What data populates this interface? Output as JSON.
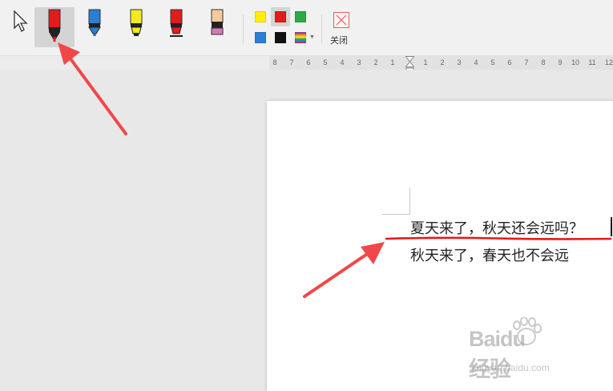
{
  "toolbar": {
    "tools": [
      {
        "name": "pointer-tool",
        "icon": "cursor-arrow-icon",
        "selected": false
      },
      {
        "name": "red-pen-tool",
        "icon": "pen-icon",
        "color": "#e31b1b",
        "selected": true
      },
      {
        "name": "blue-pen-tool",
        "icon": "pen-icon",
        "color": "#2a7fd4",
        "selected": false
      },
      {
        "name": "yellow-highlighter-tool",
        "icon": "highlighter-icon",
        "color": "#f2ea1d",
        "selected": false
      },
      {
        "name": "red-highlighter-tool",
        "icon": "highlighter-icon",
        "color": "#e31b1b",
        "selected": false
      },
      {
        "name": "eraser-tool",
        "icon": "eraser-icon",
        "color": "#f7c99a",
        "selected": false
      }
    ],
    "colors": [
      "#ffee00",
      "#e31b1b",
      "#2ea84a",
      "#2a7fd4",
      "#111111",
      "multicolor"
    ],
    "selected_color": "#e31b1b",
    "close_label": "关闭"
  },
  "ruler": {
    "left_ticks": [
      "8",
      "7",
      "6",
      "5",
      "4",
      "3",
      "2",
      "1"
    ],
    "right_ticks": [
      "1",
      "2",
      "3",
      "4",
      "5",
      "6",
      "7",
      "8",
      "9",
      "10",
      "11",
      "12"
    ]
  },
  "document": {
    "line1": "夏天来了，秋天还会远吗？",
    "line2": "秋天来了，春天也不会远",
    "ink_color": "#e31b1b"
  },
  "annotations": {
    "arrow_color": "#f04848"
  },
  "watermark": {
    "logo": "Baidu经验",
    "url": "jingyan.baidu.com"
  }
}
